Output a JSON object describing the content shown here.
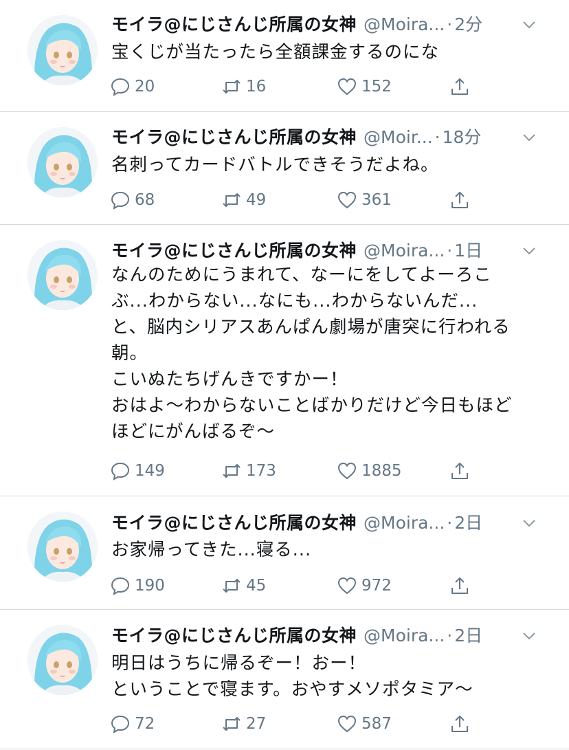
{
  "colors": {
    "text": "#14171a",
    "muted": "#657786",
    "separator": "#d9d9d9"
  },
  "tweets": [
    {
      "name": "モイラ@にじさんじ所属の女神",
      "handle": "@Moira...",
      "time": "2分",
      "text": "宝くじが当たったら全額課金するのにな",
      "replies": "20",
      "retweets": "16",
      "likes": "152"
    },
    {
      "name": "モイラ@にじさんじ所属の女神",
      "handle": "@Moir...",
      "time": "18分",
      "text": "名刺ってカードバトルできそうだよね。",
      "replies": "68",
      "retweets": "49",
      "likes": "361"
    },
    {
      "name": "モイラ@にじさんじ所属の女神",
      "handle": "@Moira...",
      "time": "1日",
      "text": "なんのためにうまれて、なーにをしてよーろこ\nぶ...わからない...なにも...わからないんだ...\nと、脳内シリアスあんぱん劇場が唐突に行われる\n朝。\nこいぬたちげんきですかー！\nおはよ〜わからないことばかりだけど今日もほど\nほどにがんばるぞ〜",
      "replies": "149",
      "retweets": "173",
      "likes": "1885"
    },
    {
      "name": "モイラ@にじさんじ所属の女神",
      "handle": "@Moira...",
      "time": "2日",
      "text": "お家帰ってきた...寝る...",
      "replies": "190",
      "retweets": "45",
      "likes": "972"
    },
    {
      "name": "モイラ@にじさんじ所属の女神",
      "handle": "@Moira...",
      "time": "2日",
      "text": "明日はうちに帰るぞー！おー！\nということで寝ます。おやすメソポタミア〜",
      "replies": "72",
      "retweets": "27",
      "likes": "587"
    }
  ]
}
